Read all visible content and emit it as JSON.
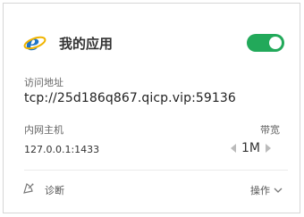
{
  "app": {
    "icon": "internet-explorer-icon",
    "title": "我的应用",
    "enabled": true
  },
  "access": {
    "label": "访问地址",
    "address": "tcp://25d186q867.qicp.vip:59136"
  },
  "lan_host": {
    "label": "内网主机",
    "value": "127.0.0.1:1433"
  },
  "bandwidth": {
    "label": "带宽",
    "value": "1M"
  },
  "footer": {
    "diagnose_label": "诊断",
    "operations_label": "操作"
  },
  "colors": {
    "toggle_on": "#22a95a",
    "ie_blue": "#1e74c7"
  }
}
